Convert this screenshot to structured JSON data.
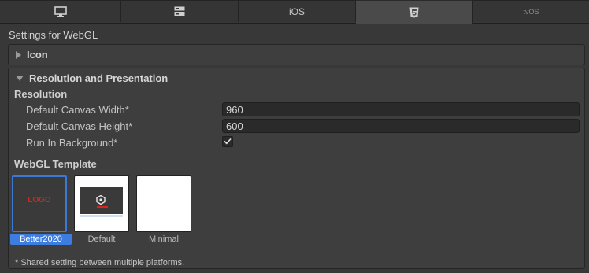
{
  "tabs": [
    {
      "name": "standalone",
      "icon": "monitor-icon",
      "label": ""
    },
    {
      "name": "server",
      "icon": "server-icon",
      "label": ""
    },
    {
      "name": "ios",
      "icon": "",
      "label": "iOS"
    },
    {
      "name": "webgl",
      "icon": "html5-icon",
      "label": "",
      "active": true
    },
    {
      "name": "tvos",
      "icon": "",
      "label": "tvOS"
    }
  ],
  "settings_title": "Settings for WebGL",
  "icon_section": {
    "label": "Icon",
    "expanded": false
  },
  "resolution_section": {
    "label": "Resolution and Presentation",
    "expanded": true,
    "resolution_heading": "Resolution",
    "fields": [
      {
        "label": "Default Canvas Width*",
        "value": "960"
      },
      {
        "label": "Default Canvas Height*",
        "value": "600"
      },
      {
        "label": "Run In Background*",
        "checked": true
      }
    ],
    "template_heading": "WebGL Template",
    "templates": [
      {
        "name": "Better2020",
        "logo_text": "LOGO",
        "selected": true
      },
      {
        "name": "Default",
        "selected": false
      },
      {
        "name": "Minimal",
        "selected": false
      }
    ],
    "footnote": "* Shared setting between multiple platforms."
  },
  "colors": {
    "accent": "#3e7de0",
    "logo_red": "#e0201a"
  }
}
